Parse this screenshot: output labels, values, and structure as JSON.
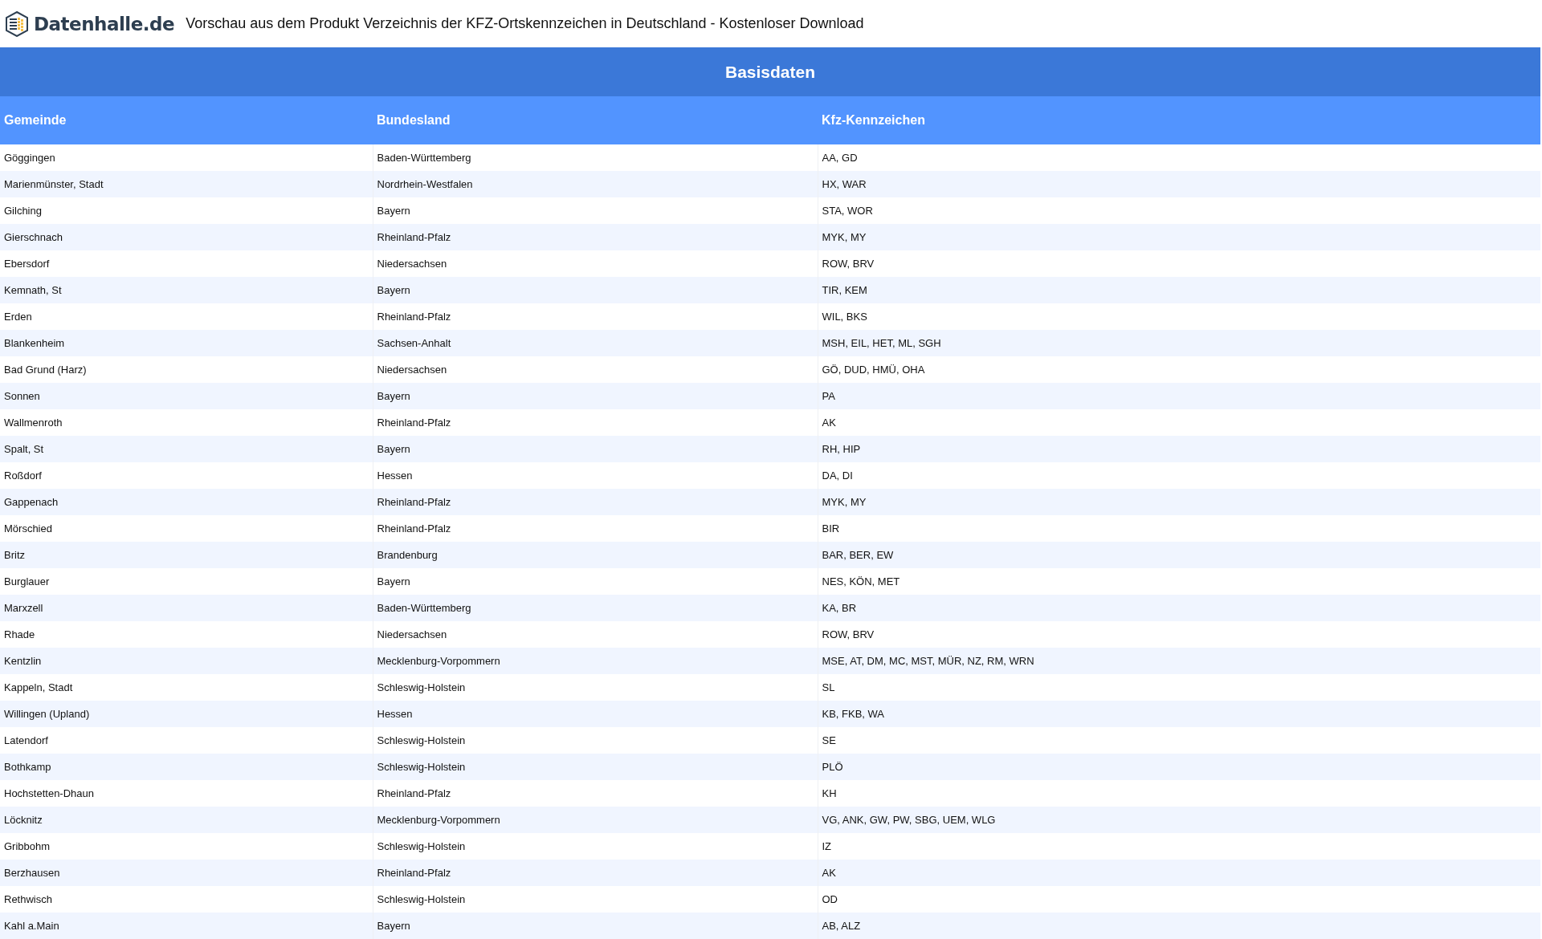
{
  "header": {
    "logo_text": "Datenhalle.de",
    "title": "Vorschau aus dem Produkt Verzeichnis der KFZ-Ortskennzeichen in Deutschland - Kostenloser Download"
  },
  "table": {
    "caption": "Basisdaten",
    "columns": [
      "Gemeinde",
      "Bundesland",
      "Kfz-Kennzeichen"
    ],
    "rows": [
      [
        "Göggingen",
        "Baden-Württemberg",
        "AA, GD"
      ],
      [
        "Marienmünster, Stadt",
        "Nordrhein-Westfalen",
        "HX, WAR"
      ],
      [
        "Gilching",
        "Bayern",
        "STA, WOR"
      ],
      [
        "Gierschnach",
        "Rheinland-Pfalz",
        "MYK, MY"
      ],
      [
        "Ebersdorf",
        "Niedersachsen",
        "ROW, BRV"
      ],
      [
        "Kemnath, St",
        "Bayern",
        "TIR, KEM"
      ],
      [
        "Erden",
        "Rheinland-Pfalz",
        "WIL, BKS"
      ],
      [
        "Blankenheim",
        "Sachsen-Anhalt",
        "MSH, EIL, HET, ML, SGH"
      ],
      [
        "Bad Grund (Harz)",
        "Niedersachsen",
        "GÖ, DUD, HMÜ, OHA"
      ],
      [
        "Sonnen",
        "Bayern",
        "PA"
      ],
      [
        "Wallmenroth",
        "Rheinland-Pfalz",
        "AK"
      ],
      [
        "Spalt, St",
        "Bayern",
        "RH, HIP"
      ],
      [
        "Roßdorf",
        "Hessen",
        "DA, DI"
      ],
      [
        "Gappenach",
        "Rheinland-Pfalz",
        "MYK, MY"
      ],
      [
        "Mörschied",
        "Rheinland-Pfalz",
        "BIR"
      ],
      [
        "Britz",
        "Brandenburg",
        "BAR, BER, EW"
      ],
      [
        "Burglauer",
        "Bayern",
        "NES, KÖN, MET"
      ],
      [
        "Marxzell",
        "Baden-Württemberg",
        "KA, BR"
      ],
      [
        "Rhade",
        "Niedersachsen",
        "ROW, BRV"
      ],
      [
        "Kentzlin",
        "Mecklenburg-Vorpommern",
        "MSE, AT, DM, MC, MST, MÜR, NZ, RM, WRN"
      ],
      [
        "Kappeln, Stadt",
        "Schleswig-Holstein",
        "SL"
      ],
      [
        "Willingen (Upland)",
        "Hessen",
        "KB, FKB, WA"
      ],
      [
        "Latendorf",
        "Schleswig-Holstein",
        "SE"
      ],
      [
        "Bothkamp",
        "Schleswig-Holstein",
        "PLÖ"
      ],
      [
        "Hochstetten-Dhaun",
        "Rheinland-Pfalz",
        "KH"
      ],
      [
        "Löcknitz",
        "Mecklenburg-Vorpommern",
        "VG, ANK, GW, PW, SBG, UEM, WLG"
      ],
      [
        "Gribbohm",
        "Schleswig-Holstein",
        "IZ"
      ],
      [
        "Berzhausen",
        "Rheinland-Pfalz",
        "AK"
      ],
      [
        "Rethwisch",
        "Schleswig-Holstein",
        "OD"
      ],
      [
        "Kahl a.Main",
        "Bayern",
        "AB, ALZ"
      ]
    ]
  }
}
